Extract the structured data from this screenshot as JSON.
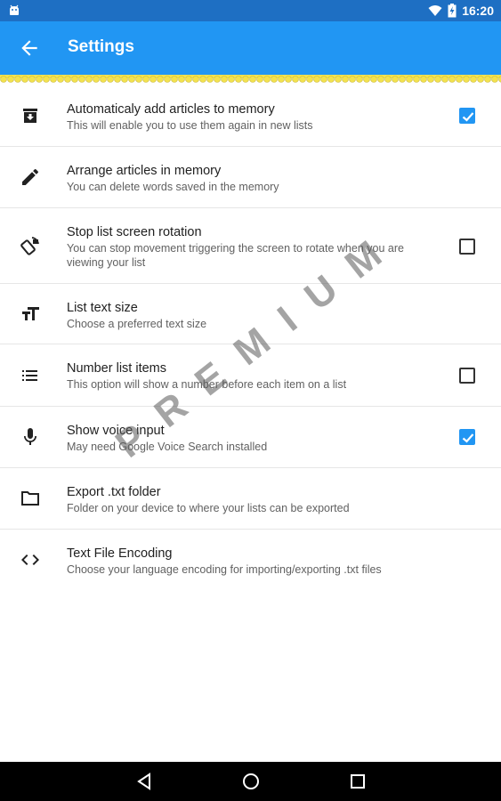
{
  "status_bar": {
    "time": "16:20",
    "icons": [
      "android-icon",
      "wifi-icon",
      "battery-charging-icon"
    ]
  },
  "app_bar": {
    "title": "Settings",
    "back_icon": "arrow-back-icon"
  },
  "colors": {
    "primary": "#2196f3",
    "status": "#1e6fc3",
    "lace": "#f3e24e"
  },
  "settings": [
    {
      "icon": "archive-icon",
      "title": "Automaticaly add articles to memory",
      "summary": "This will enable you to use them again in new lists",
      "checkbox": "checked"
    },
    {
      "icon": "pencil-icon",
      "title": "Arrange articles in memory",
      "summary": "You can delete words saved in the memory",
      "checkbox": "none"
    },
    {
      "icon": "screen-rotation-icon",
      "title": "Stop list screen rotation",
      "summary": "You can stop movement triggering the screen to rotate when you are viewing your list",
      "checkbox": "unchecked"
    },
    {
      "icon": "text-size-icon",
      "title": "List text size",
      "summary": "Choose a preferred text size",
      "checkbox": "none"
    },
    {
      "icon": "numbered-list-icon",
      "title": "Number list items",
      "summary": "This option will show a number before each item on a list",
      "checkbox": "unchecked"
    },
    {
      "icon": "microphone-icon",
      "title": "Show voice input",
      "summary": "May need Google Voice Search installed",
      "checkbox": "checked"
    },
    {
      "icon": "folder-icon",
      "title": "Export .txt folder",
      "summary": "Folder on your device to where your lists can be exported",
      "checkbox": "none"
    },
    {
      "icon": "code-icon",
      "title": "Text File Encoding",
      "summary": "Choose your language encoding for importing/exporting .txt files",
      "checkbox": "none"
    }
  ],
  "watermark": "PREMIUM",
  "nav_bar": {
    "icons": [
      "back-triangle-icon",
      "home-circle-icon",
      "recents-square-icon"
    ]
  }
}
